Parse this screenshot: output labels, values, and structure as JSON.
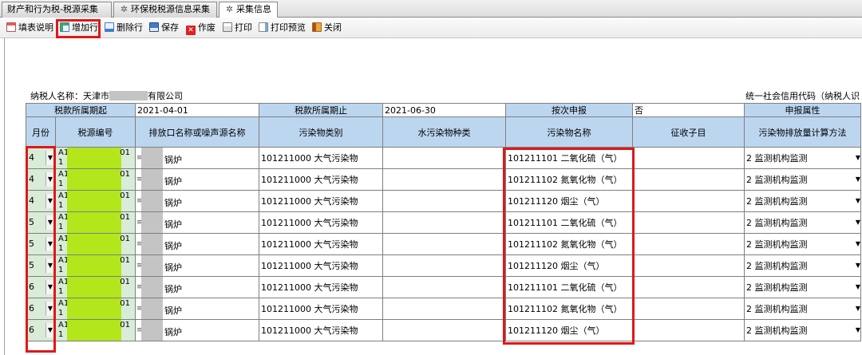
{
  "tabs": [
    {
      "label": "财产和行为税-税源采集"
    },
    {
      "label": "环保税税源信息采集"
    },
    {
      "label": "采集信息"
    }
  ],
  "toolbar": {
    "instructions": "填表说明",
    "add_row": "增加行",
    "delete_row": "删除行",
    "save": "保存",
    "void": "作废",
    "print": "打印",
    "print_preview": "打印预览",
    "close": "关闭"
  },
  "info": {
    "taxpayer_name_label": "纳税人名称：",
    "taxpayer_name_prefix": "天津市",
    "taxpayer_name_suffix": "有限公司",
    "credit_code_label": "统一社会信用代码（纳税人识"
  },
  "header": {
    "period_start_label": "税款所属期起",
    "period_start_value": "2021-04-01",
    "period_end_label": "税款所属期止",
    "period_end_value": "2021-06-30",
    "per_time_label": "按次申报",
    "per_time_value": "否",
    "declare_attr_label": "申报属性"
  },
  "columns": {
    "month": "月份",
    "source_no": "税源编号",
    "outlet": "排放口名称或噪声源名称",
    "pollutant_category": "污染物类别",
    "water_type": "水污染物种类",
    "pollutant_name": "污染物名称",
    "sub_item": "征收子目",
    "calc_method": "污染物排放量计算方法"
  },
  "rows": [
    {
      "month": "4",
      "src_a": "A1",
      "src_b": "1",
      "src_num": "01",
      "outlet": "锅炉",
      "category": "101211000 大气污染物",
      "water": "",
      "pollutant": "101211101 二氧化硫（气）",
      "sub": "",
      "method": "2 监测机构监测"
    },
    {
      "month": "4",
      "src_a": "A1",
      "src_b": "1",
      "src_num": "01",
      "outlet": "锅炉",
      "category": "101211000 大气污染物",
      "water": "",
      "pollutant": "101211102 氮氧化物（气）",
      "sub": "",
      "method": "2 监测机构监测"
    },
    {
      "month": "4",
      "src_a": "A1",
      "src_b": "1",
      "src_num": "01",
      "outlet": "锅炉",
      "category": "101211000 大气污染物",
      "water": "",
      "pollutant": "101211120 烟尘（气）",
      "sub": "",
      "method": "2 监测机构监测"
    },
    {
      "month": "5",
      "src_a": "A1",
      "src_b": "1",
      "src_num": "01",
      "outlet": "锅炉",
      "category": "101211000 大气污染物",
      "water": "",
      "pollutant": "101211101 二氧化硫（气）",
      "sub": "",
      "method": "2 监测机构监测"
    },
    {
      "month": "5",
      "src_a": "A1",
      "src_b": "1",
      "src_num": "01",
      "outlet": "锅炉",
      "category": "101211000 大气污染物",
      "water": "",
      "pollutant": "101211102 氮氧化物（气）",
      "sub": "",
      "method": "2 监测机构监测"
    },
    {
      "month": "5",
      "src_a": "A1",
      "src_b": "1",
      "src_num": "01",
      "outlet": "锅炉",
      "category": "101211000 大气污染物",
      "water": "",
      "pollutant": "101211120 烟尘（气）",
      "sub": "",
      "method": "2 监测机构监测"
    },
    {
      "month": "6",
      "src_a": "A1",
      "src_b": "1",
      "src_num": "01",
      "outlet": "锅炉",
      "category": "101211000 大气污染物",
      "water": "",
      "pollutant": "101211101 二氧化硫（气）",
      "sub": "",
      "method": "2 监测机构监测"
    },
    {
      "month": "6",
      "src_a": "A1",
      "src_b": "1",
      "src_num": "01",
      "outlet": "锅炉",
      "category": "101211000 大气污染物",
      "water": "",
      "pollutant": "101211102 氮氧化物（气）",
      "sub": "",
      "method": "2 监测机构监测"
    },
    {
      "month": "6",
      "src_a": "A1",
      "src_b": "1",
      "src_num": "01",
      "outlet": "锅炉",
      "category": "101211000 大气污染物",
      "water": "",
      "pollutant": "101211120 烟尘（气）",
      "sub": "",
      "method": "2 监测机构监测"
    }
  ],
  "colors": {
    "header_blue": "#bcd6f0",
    "editable_green": "#d8ecd8",
    "highlight_red": "#e01818",
    "redaction_green": "#b3e61b"
  }
}
